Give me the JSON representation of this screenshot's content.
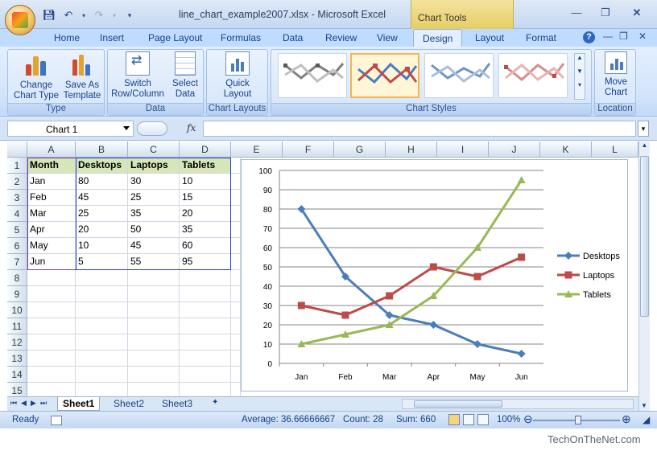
{
  "titlebar": {
    "window_title": "line_chart_example2007.xlsx - Microsoft Excel",
    "context_title": "Chart Tools"
  },
  "ribbon_tabs": [
    "Home",
    "Insert",
    "Page Layout",
    "Formulas",
    "Data",
    "Review",
    "View",
    "Design",
    "Layout",
    "Format"
  ],
  "active_tab": "Design",
  "ribbon": {
    "type_group": {
      "label": "Type",
      "change_chart_type": "Change\nChart Type",
      "save_as_template": "Save As\nTemplate"
    },
    "data_group": {
      "label": "Data",
      "switch_row_column": "Switch\nRow/Column",
      "select_data": "Select\nData"
    },
    "chart_layouts_group": {
      "label": "Chart Layouts",
      "quick_layout": "Quick\nLayout"
    },
    "chart_styles_group": {
      "label": "Chart Styles"
    },
    "location_group": {
      "label": "Location",
      "move_chart": "Move\nChart"
    }
  },
  "formula_bar": {
    "name_box": "Chart 1",
    "fx": "fx",
    "value": ""
  },
  "columns": [
    "A",
    "B",
    "C",
    "D",
    "E",
    "F",
    "G",
    "H",
    "I",
    "J",
    "K",
    "L"
  ],
  "rows": [
    "1",
    "2",
    "3",
    "4",
    "5",
    "6",
    "7",
    "8",
    "9",
    "10",
    "11",
    "12",
    "13",
    "14",
    "15"
  ],
  "table": {
    "headers": [
      "Month",
      "Desktops",
      "Laptops",
      "Tablets"
    ],
    "data": [
      [
        "Jan",
        "80",
        "30",
        "10"
      ],
      [
        "Feb",
        "45",
        "25",
        "15"
      ],
      [
        "Mar",
        "25",
        "35",
        "20"
      ],
      [
        "Apr",
        "20",
        "50",
        "35"
      ],
      [
        "May",
        "10",
        "45",
        "60"
      ],
      [
        "Jun",
        "5",
        "55",
        "95"
      ]
    ]
  },
  "chart_data": {
    "type": "line",
    "categories": [
      "Jan",
      "Feb",
      "Mar",
      "Apr",
      "May",
      "Jun"
    ],
    "series": [
      {
        "name": "Desktops",
        "values": [
          80,
          45,
          25,
          20,
          10,
          5
        ],
        "color": "#4a7ebb",
        "marker": "diamond"
      },
      {
        "name": "Laptops",
        "values": [
          30,
          25,
          35,
          50,
          45,
          55
        ],
        "color": "#be4b48",
        "marker": "square"
      },
      {
        "name": "Tablets",
        "values": [
          10,
          15,
          20,
          35,
          60,
          95
        ],
        "color": "#98b954",
        "marker": "triangle"
      }
    ],
    "yticks": [
      "0",
      "10",
      "20",
      "30",
      "40",
      "50",
      "60",
      "70",
      "80",
      "90",
      "100"
    ],
    "ylim": [
      0,
      100
    ],
    "grid": true,
    "legend": "right"
  },
  "sheet_tabs": [
    "Sheet1",
    "Sheet2",
    "Sheet3"
  ],
  "active_sheet": "Sheet1",
  "statusbar": {
    "ready": "Ready",
    "average": "Average: 36.66666667",
    "count": "Count: 28",
    "sum": "Sum: 660",
    "zoom": "100%"
  },
  "watermark": "TechOnTheNet.com"
}
